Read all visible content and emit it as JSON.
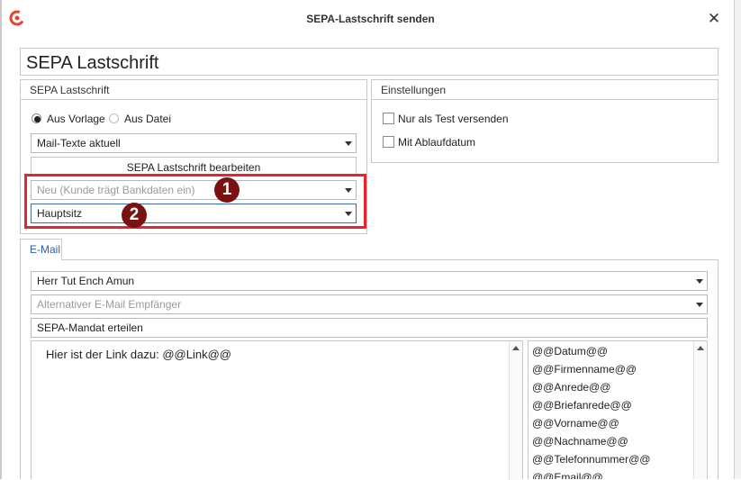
{
  "window": {
    "title": "SEPA-Lastschrift senden"
  },
  "header": {
    "big_title": "SEPA Lastschrift"
  },
  "sepa_group": {
    "title": "SEPA Lastschrift",
    "radio_vorlage": "Aus Vorlage",
    "radio_datei": "Aus Datei",
    "radio_selected": "Aus Vorlage",
    "template_combo": "Mail-Texte aktuell",
    "edit_button": "SEPA Lastschrift bearbeiten",
    "mandate_combo": "Neu (Kunde trägt Bankdaten ein)",
    "address_combo": "Hauptsitz"
  },
  "settings_group": {
    "title": "Einstellungen",
    "test_label": "Nur als Test versenden",
    "test_checked": false,
    "expiry_label": "Mit Ablaufdatum",
    "expiry_checked": false
  },
  "annotations": {
    "badge1": "1",
    "badge2": "2",
    "highlight_color": "#e2262b",
    "badge_color": "#7a1212"
  },
  "email": {
    "tab_label": "E-Mail",
    "recipient": "Herr Tut Ench Amun",
    "alt_recipient_placeholder": "Alternativer E-Mail Empfänger",
    "subject": "SEPA-Mandat erteilen",
    "body": "Hier ist der Link dazu: @@Link@@",
    "placeholders": [
      "@@Datum@@",
      "@@Firmenname@@",
      "@@Anrede@@",
      "@@Briefanrede@@",
      "@@Vorname@@",
      "@@Nachname@@",
      "@@Telefonnummer@@",
      "@@Email@@"
    ]
  },
  "colors": {
    "accent": "#2a5ea8",
    "logo": "#e8452c"
  }
}
